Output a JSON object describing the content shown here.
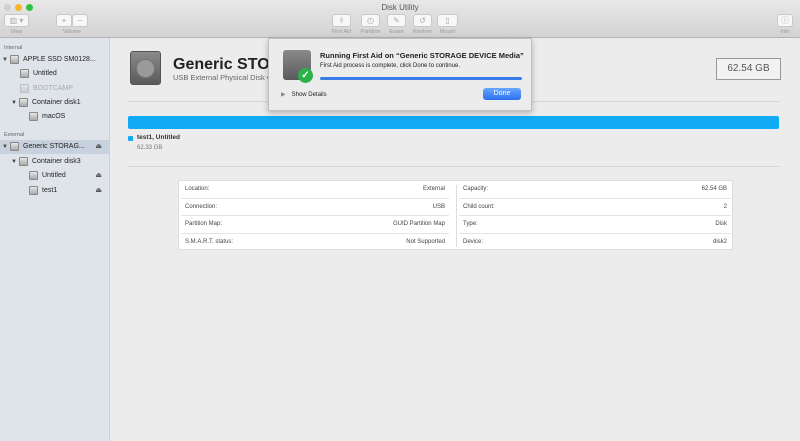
{
  "window": {
    "title": "Disk Utility"
  },
  "toolbar": {
    "view": "View",
    "volume": "Volume",
    "add": "+",
    "remove": "−",
    "first_aid": "First Aid",
    "partition": "Partition",
    "erase": "Erase",
    "restore": "Restore",
    "mount": "Mount",
    "info": "Info"
  },
  "sidebar": {
    "internal": "Internal",
    "external": "External",
    "items": [
      {
        "label": "APPLE SSD SM0128...",
        "level": 0
      },
      {
        "label": "Untitled",
        "level": 1
      },
      {
        "label": "BOOTCAMP",
        "level": 1
      },
      {
        "label": "Container disk1",
        "level": 1
      },
      {
        "label": "macOS",
        "level": 2
      },
      {
        "label": "Generic STORAG...",
        "level": 0
      },
      {
        "label": "Container disk3",
        "level": 1
      },
      {
        "label": "Untitled",
        "level": 2
      },
      {
        "label": "test1",
        "level": 2
      }
    ]
  },
  "disk": {
    "name": "Generic STORAGE DEVICE Media",
    "subtitle": "USB External Physical Disk • GUID Partition Map",
    "size": "62.54 GB",
    "bar_color": "#10aaf5",
    "legend_name": "test1, Untitled",
    "legend_size": "62.33 GB"
  },
  "dialog": {
    "title": "Running First Aid on “Generic STORAGE DEVICE Media”",
    "message": "First Aid process is complete, click Done to continue.",
    "progress": 100,
    "show_details": "Show Details",
    "done": "Done"
  },
  "info": {
    "left": [
      {
        "k": "Location:",
        "v": "External"
      },
      {
        "k": "Connection:",
        "v": "USB"
      },
      {
        "k": "Partition Map:",
        "v": "GUID Partition Map"
      },
      {
        "k": "S.M.A.R.T. status:",
        "v": "Not Supported"
      }
    ],
    "right": [
      {
        "k": "Capacity:",
        "v": "62.54 GB"
      },
      {
        "k": "Child count:",
        "v": "2"
      },
      {
        "k": "Type:",
        "v": "Disk"
      },
      {
        "k": "Device:",
        "v": "disk2"
      }
    ]
  }
}
